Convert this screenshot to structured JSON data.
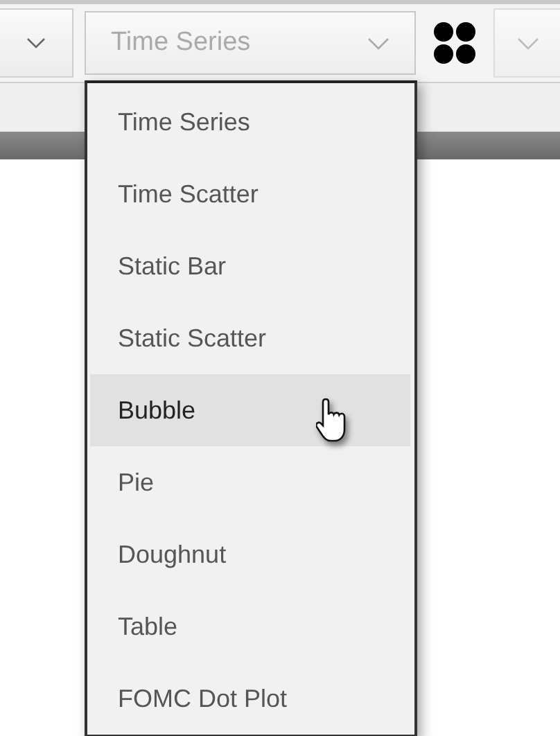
{
  "chart_type_select": {
    "value": "Time Series",
    "expanded": true
  },
  "chart_type_menu": [
    {
      "label": "Time Series",
      "selected": false
    },
    {
      "label": "Time Scatter",
      "selected": false
    },
    {
      "label": "Static Bar",
      "selected": false
    },
    {
      "label": "Static Scatter",
      "selected": false
    },
    {
      "label": "Bubble",
      "selected": true
    },
    {
      "label": "Pie",
      "selected": false
    },
    {
      "label": "Doughnut",
      "selected": false
    },
    {
      "label": "Table",
      "selected": false
    },
    {
      "label": "FOMC Dot Plot",
      "selected": false
    }
  ]
}
